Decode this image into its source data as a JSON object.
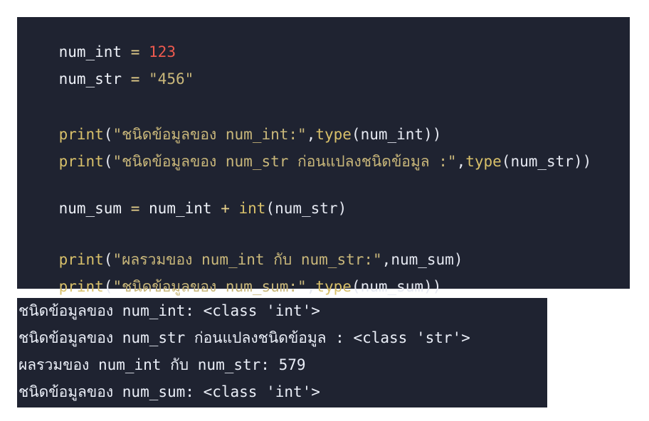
{
  "code": {
    "line1": {
      "var": "num_int",
      "op": " = ",
      "value": "123"
    },
    "line2": {
      "var": "num_str",
      "op": " = ",
      "value": "\"456\""
    },
    "line3": {
      "fn": "print",
      "open": "(",
      "str": "\"ชนิดข้อมูลของ num_int:\"",
      "comma": ",",
      "call": "type",
      "arg": "(num_int))"
    },
    "line4": {
      "fn": "print",
      "open": "(",
      "str": "\"ชนิดข้อมูลของ num_str ก่อนแปลงชนิดข้อมูล :\"",
      "comma": ",",
      "call": "type",
      "arg": "(num_str))"
    },
    "line5": {
      "var": "num_sum",
      "op": " = ",
      "var2": "num_int",
      "plus": " + ",
      "call": "int",
      "arg": "(num_str)"
    },
    "line6": {
      "fn": "print",
      "open": "(",
      "str": "\"ผลรวมของ num_int กับ num_str:\"",
      "comma": ",",
      "arg": "num_sum)"
    },
    "line7": {
      "fn": "print",
      "open": "(",
      "str": "\"ชนิดข้อมูลของ num_sum:\"",
      "comma": ",",
      "call": "type",
      "arg": "(num_sum))"
    }
  },
  "output": {
    "lines": [
      "ชนิดข้อมูลของ num_int: <class 'int'>",
      "ชนิดข้อมูลของ num_str ก่อนแปลงชนิดข้อมูล : <class 'str'>",
      "ผลรวมของ num_int กับ num_str: 579",
      "ชนิดข้อมูลของ num_sum: <class 'int'>"
    ]
  }
}
